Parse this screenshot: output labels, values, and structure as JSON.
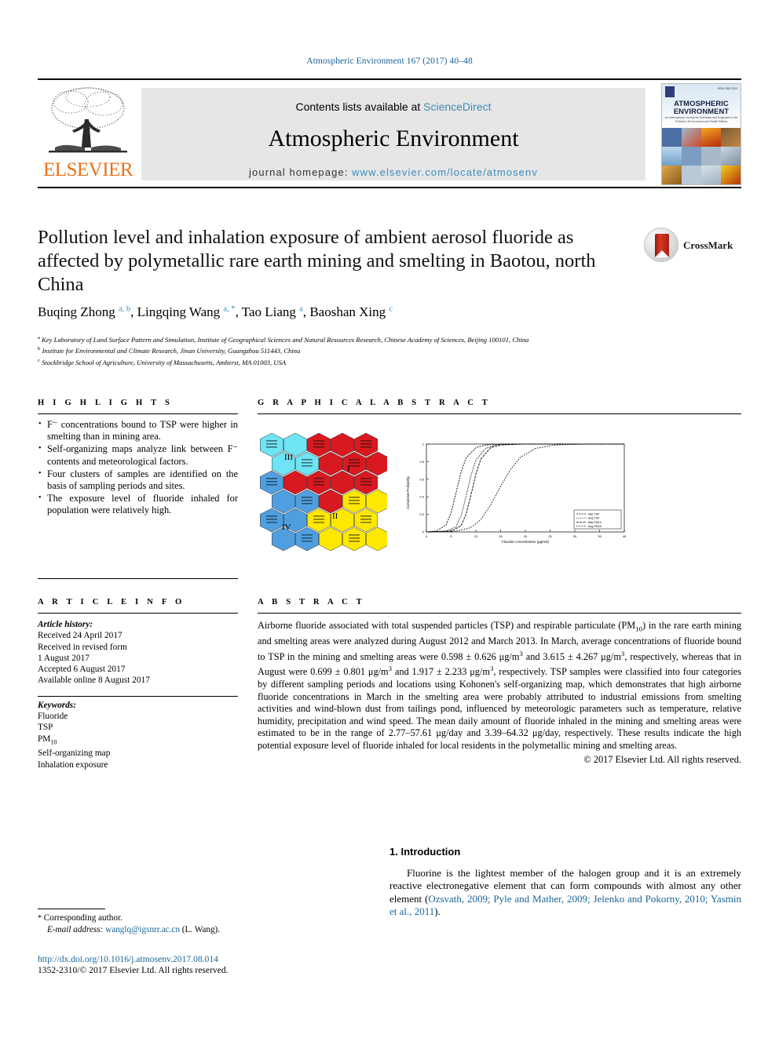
{
  "running_head": "Atmospheric Environment 167 (2017) 40–48",
  "masthead": {
    "publisher": "ELSEVIER",
    "contents_prefix": "Contents lists available at ",
    "sciencedirect": "ScienceDirect",
    "journal_name": "Atmospheric Environment",
    "homepage_prefix": "journal homepage: ",
    "homepage_url": "www.elsevier.com/locate/atmosenv",
    "cover": {
      "title_line1": "ATMOSPHERIC",
      "title_line2": "ENVIRONMENT",
      "subtitle": "An International Journal for Scientists and Engineers in Air Pollution, Environment and Health Effects",
      "issn_note": "ISSN 1352-2310"
    }
  },
  "article": {
    "title": "Pollution level and inhalation exposure of ambient aerosol fluoride as affected by polymetallic rare earth mining and smelting in Baotou, north China",
    "crossmark_label": "CrossMark",
    "authors_html": "Buqing Zhong <sup>a, b</sup>, Lingqing Wang <sup>a, *</sup>, Tao Liang <sup>a</sup>, Baoshan Xing <sup>c</sup>",
    "affiliations": [
      {
        "marker": "a",
        "text": "Key Laboratory of Land Surface Pattern and Simulation, Institute of Geographical Sciences and Natural Resources Research, Chinese Academy of Sciences, Beijing 100101, China"
      },
      {
        "marker": "b",
        "text": "Institute for Environmental and Climate Research, Jinan University, Guangzhou 511443, China"
      },
      {
        "marker": "c",
        "text": "Stockbridge School of Agriculture, University of Massachusetts, Amherst, MA 01003, USA"
      }
    ]
  },
  "highlights": {
    "heading": "H I G H L I G H T S",
    "items": [
      "F⁻ concentrations bound to TSP were higher in smelting than in mining area.",
      "Self-organizing maps analyze link between F⁻ contents and meteorological factors.",
      "Four clusters of samples are identified on the basis of sampling periods and sites.",
      "The exposure level of fluoride inhaled for population were relatively high."
    ]
  },
  "graphical_abstract": {
    "heading": "G R A P H I C A L   A B S T R A C T"
  },
  "article_info": {
    "heading": "A R T I C L E   I N F O",
    "history_label": "Article history:",
    "history": [
      "Received 24 April 2017",
      "Received in revised form",
      "1 August 2017",
      "Accepted 6 August 2017",
      "Available online 8 August 2017"
    ],
    "keywords_label": "Keywords:",
    "keywords": [
      "Fluoride",
      "TSP",
      "PM10",
      "Self-organizing map",
      "Inhalation exposure"
    ]
  },
  "abstract": {
    "heading": "A B S T R A C T",
    "body_html": "Airborne fluoride associated with total suspended particles (TSP) and respirable particulate (PM<sub>10</sub>) in the rare earth mining and smelting areas were analyzed during August 2012 and March 2013. In March, average concentrations of fluoride bound to TSP in the mining and smelting areas were 0.598 &plusmn; 0.626 &mu;g/m<sup>3</sup> and 3.615 &plusmn; 4.267 &mu;g/m<sup>3</sup>, respectively, whereas that in August were 0.699 &plusmn; 0.801 &mu;g/m<sup>3</sup> and 1.917 &plusmn; 2.233 &mu;g/m<sup>3</sup>, respectively. TSP samples were classified into four categories by different sampling periods and locations using Kohonen's self-organizing map, which demonstrates that high airborne fluoride concentrations in March in the smelting area were probably attributed to industrial emissions from smelting activities and wind-blown dust from tailings pond, influenced by meteorologic parameters such as temperature, relative humidity, precipitation and wind speed. The mean daily amount of fluoride inhaled in the mining and smelting areas were estimated to be in the range of 2.77&ndash;57.61 &mu;g/day and 3.39&ndash;64.32 &mu;g/day, respectively. These results indicate the high potential exposure level of fluoride inhaled for local residents in the polymetallic mining and smelting areas.",
    "copyright": "© 2017 Elsevier Ltd. All rights reserved."
  },
  "introduction": {
    "heading": "1. Introduction",
    "paragraph_html": "Fluorine is the lightest member of the halogen group and it is an extremely reactive electronegative element that can form compounds with almost any other element (<span class=\"lnk\">Ozsvath, 2009; Pyle and Mather, 2009; Jelenko and Pokorny, 2010; Yasmin et al., 2011</span>)."
  },
  "footer": {
    "corresponding_marker": "*",
    "corresponding_label": "Corresponding author.",
    "email_label": "E-mail address:",
    "email": "wanglq@igsnrr.ac.cn",
    "email_owner": "(L. Wang).",
    "doi": "http://dx.doi.org/10.1016/j.atmosenv.2017.08.014",
    "issn_line": "1352-2310/© 2017 Elsevier Ltd. All rights reserved."
  },
  "chart_data": {
    "type": "line",
    "title": "",
    "xlabel": "Fluoride concentration (µg/m3)",
    "ylabel": "Cumulative Probability",
    "xlim": [
      0,
      40
    ],
    "ylim": [
      0,
      1
    ],
    "xticks": [
      0,
      5,
      10,
      15,
      20,
      25,
      30,
      35,
      40
    ],
    "yticks": [
      0,
      0.2,
      0.4,
      0.6,
      0.8,
      1
    ],
    "grid": false,
    "legend_position": "lower-right",
    "series": [
      {
        "name": "Mar-TSP",
        "x": [
          0,
          2,
          4,
          5,
          6,
          7,
          8,
          10,
          12,
          15,
          20,
          40
        ],
        "values": [
          0.0,
          0.01,
          0.08,
          0.22,
          0.45,
          0.68,
          0.84,
          0.96,
          0.99,
          1.0,
          1.0,
          1.0
        ]
      },
      {
        "name": "Aug-TSP",
        "x": [
          0,
          4,
          6,
          7,
          8,
          9,
          10,
          12,
          14,
          18,
          25,
          40
        ],
        "values": [
          0.0,
          0.01,
          0.06,
          0.18,
          0.4,
          0.64,
          0.82,
          0.95,
          0.99,
          1.0,
          1.0,
          1.0
        ]
      },
      {
        "name": "Mar-PM10",
        "x": [
          0,
          5,
          7,
          8,
          9,
          10,
          11,
          13,
          15,
          20,
          28,
          40
        ],
        "values": [
          0.0,
          0.01,
          0.07,
          0.2,
          0.42,
          0.66,
          0.83,
          0.96,
          0.99,
          1.0,
          1.0,
          1.0
        ]
      },
      {
        "name": "Aug-PM10",
        "x": [
          0,
          6,
          9,
          11,
          13,
          15,
          17,
          19,
          22,
          26,
          32,
          40
        ],
        "values": [
          0.0,
          0.01,
          0.05,
          0.14,
          0.31,
          0.52,
          0.71,
          0.85,
          0.95,
          0.99,
          1.0,
          1.0
        ]
      }
    ],
    "legend_entries": [
      "Mar-TSP",
      "Aug-TSP",
      "Mar-PM10",
      "Aug-PM10"
    ]
  },
  "som_map": {
    "type": "hexagonal-som",
    "cluster_labels": [
      "I",
      "II",
      "III",
      "IV"
    ],
    "cluster_colors": {
      "I": "#d81920",
      "II": "#ffe800",
      "III": "#6ee4f5",
      "IV": "#4f9fe0"
    }
  }
}
